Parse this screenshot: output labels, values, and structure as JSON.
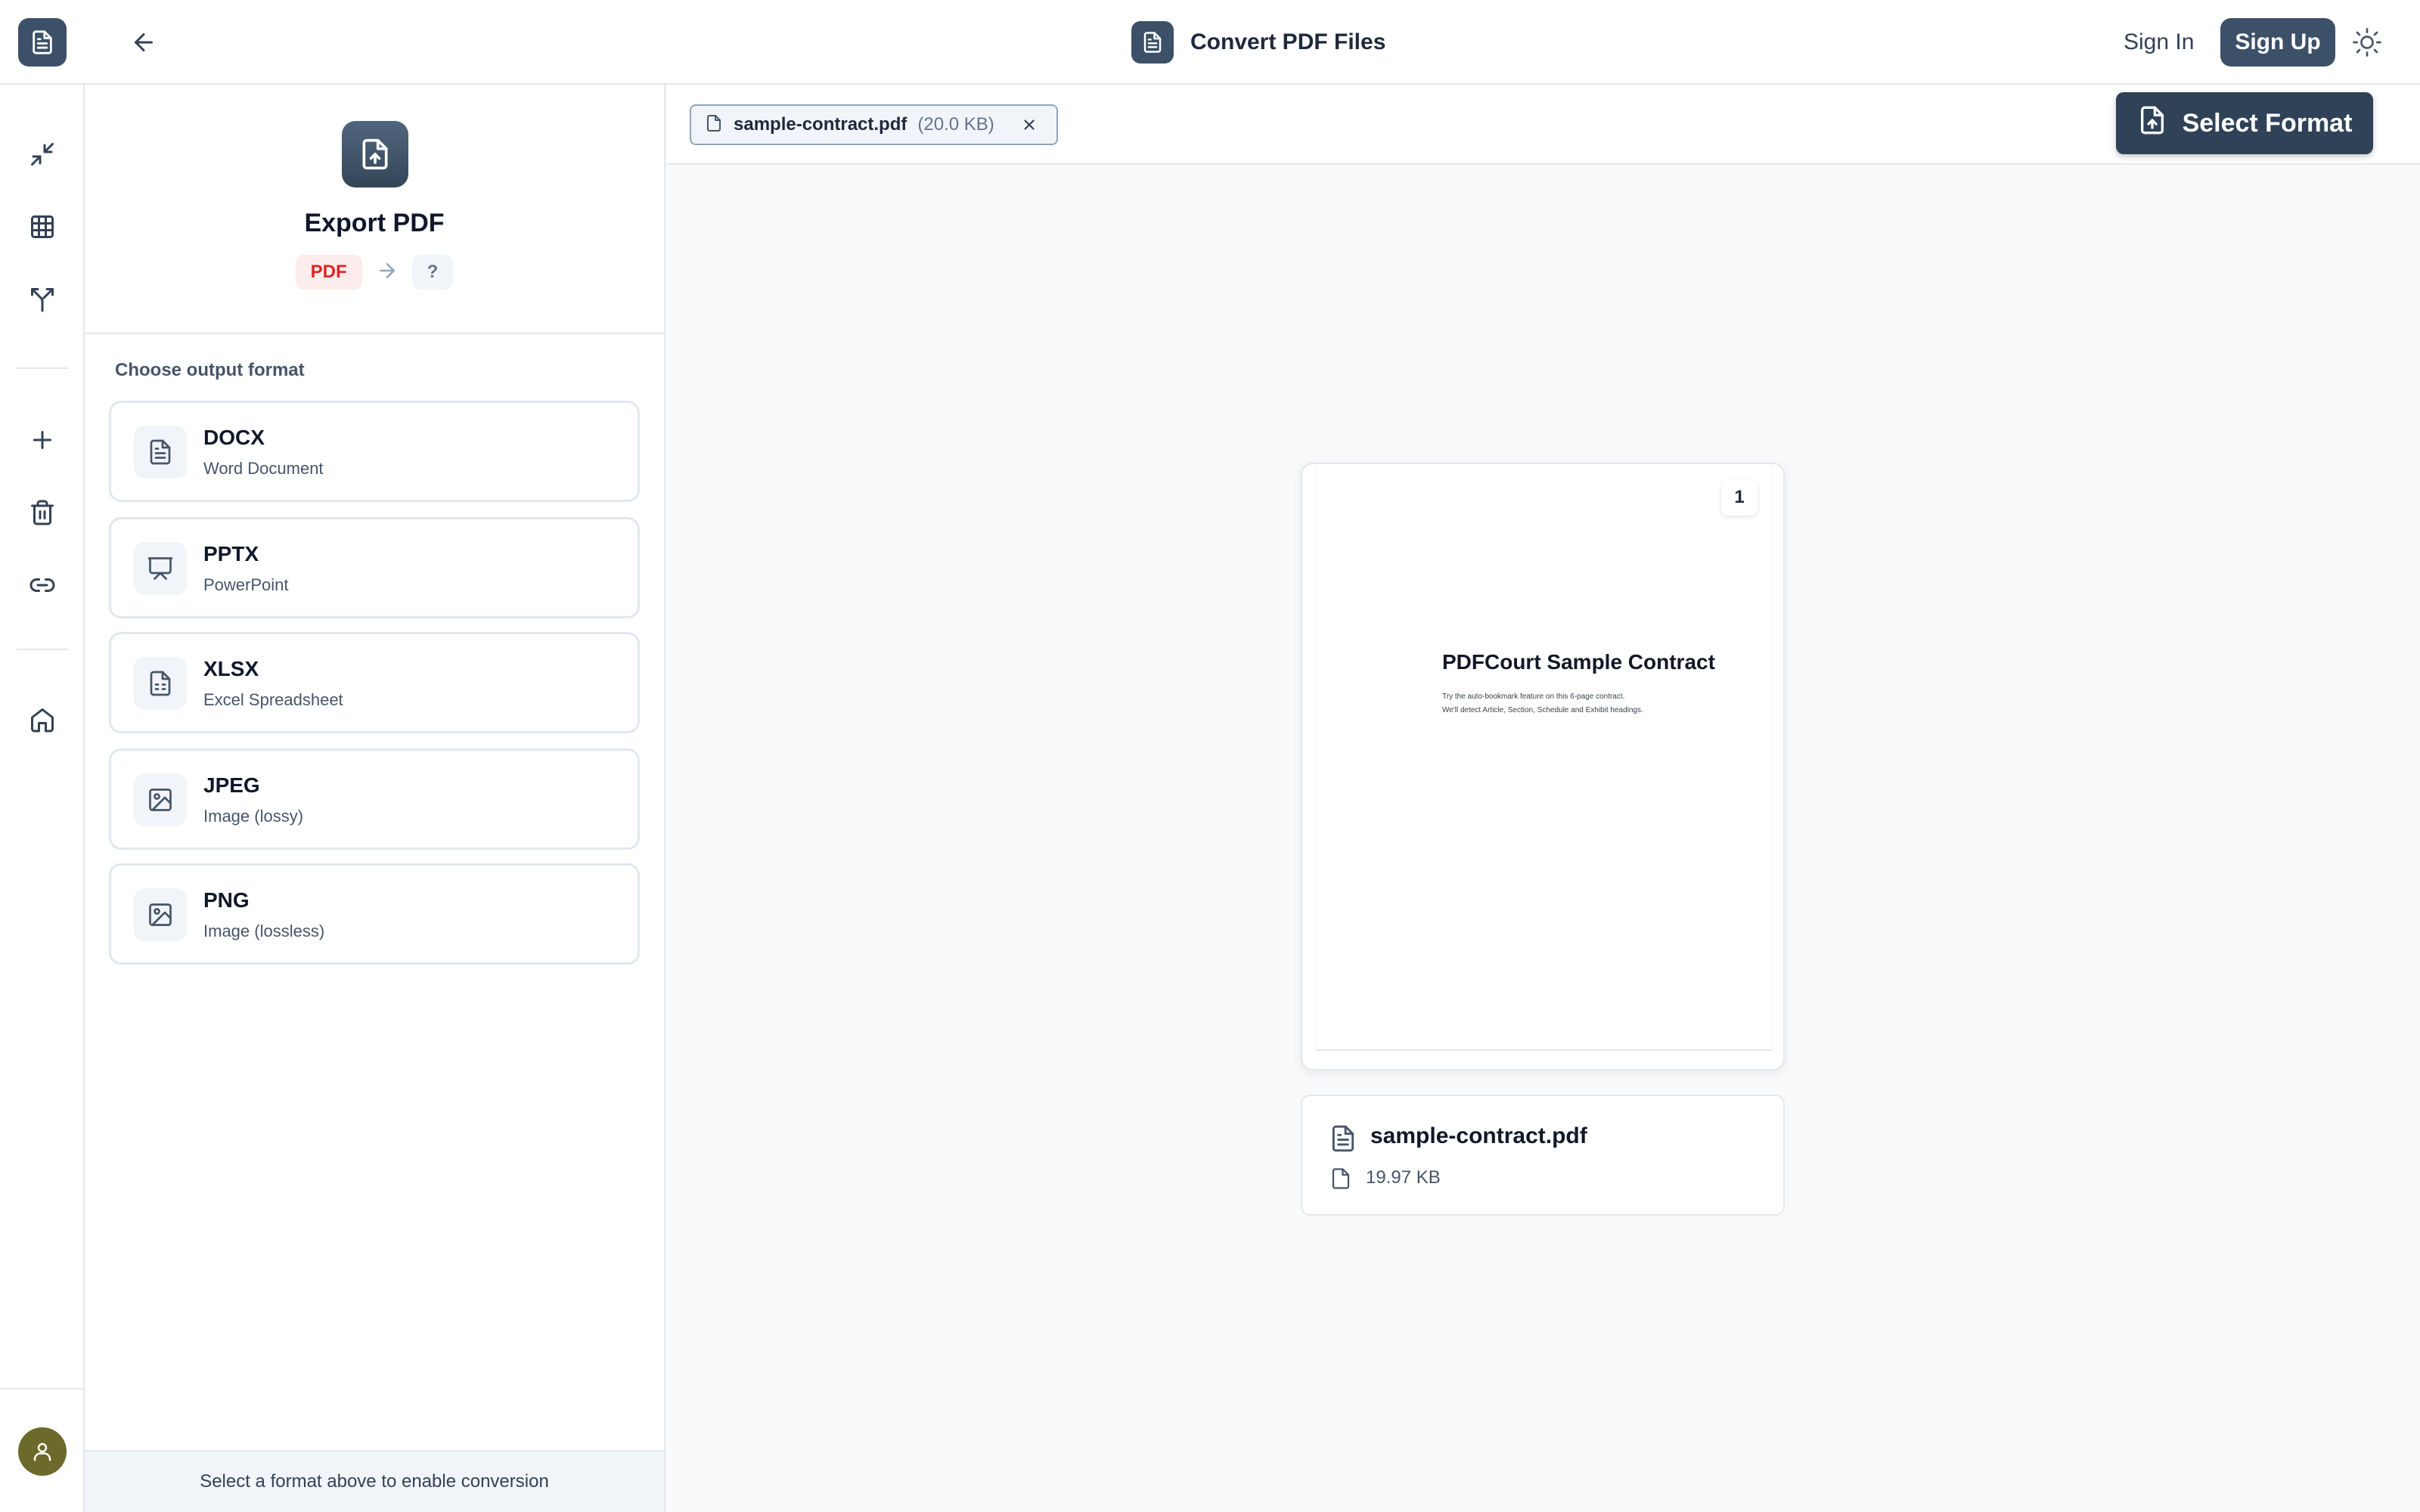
{
  "header": {
    "title": "Convert PDF Files",
    "sign_in": "Sign In",
    "sign_up": "Sign Up"
  },
  "panel": {
    "title": "Export PDF",
    "from_format": "PDF",
    "to_format": "?",
    "choose_label": "Choose output format",
    "formats": [
      {
        "name": "DOCX",
        "desc": "Word Document",
        "icon": "file-text-icon"
      },
      {
        "name": "PPTX",
        "desc": "PowerPoint",
        "icon": "presentation-icon"
      },
      {
        "name": "XLSX",
        "desc": "Excel Spreadsheet",
        "icon": "spreadsheet-icon"
      },
      {
        "name": "JPEG",
        "desc": "Image (lossy)",
        "icon": "image-icon"
      },
      {
        "name": "PNG",
        "desc": "Image (lossless)",
        "icon": "image-icon"
      }
    ],
    "footer": "Select a format above to enable conversion"
  },
  "file": {
    "chip_name": "sample-contract.pdf",
    "chip_size": "(20.0 KB)",
    "name": "sample-contract.pdf",
    "size": "19.97 KB"
  },
  "toolbar": {
    "select_format": "Select Format"
  },
  "preview": {
    "page_number": "1",
    "doc_title": "PDFCourt Sample Contract",
    "doc_line1": "Try the auto-bookmark feature on this 6-page contract.",
    "doc_line2": "We'll detect Article, Section, Schedule and Exhibit headings."
  },
  "colors": {
    "accent": "#3c5068",
    "danger": "#dc2626",
    "avatar": "#6b6a2a"
  }
}
